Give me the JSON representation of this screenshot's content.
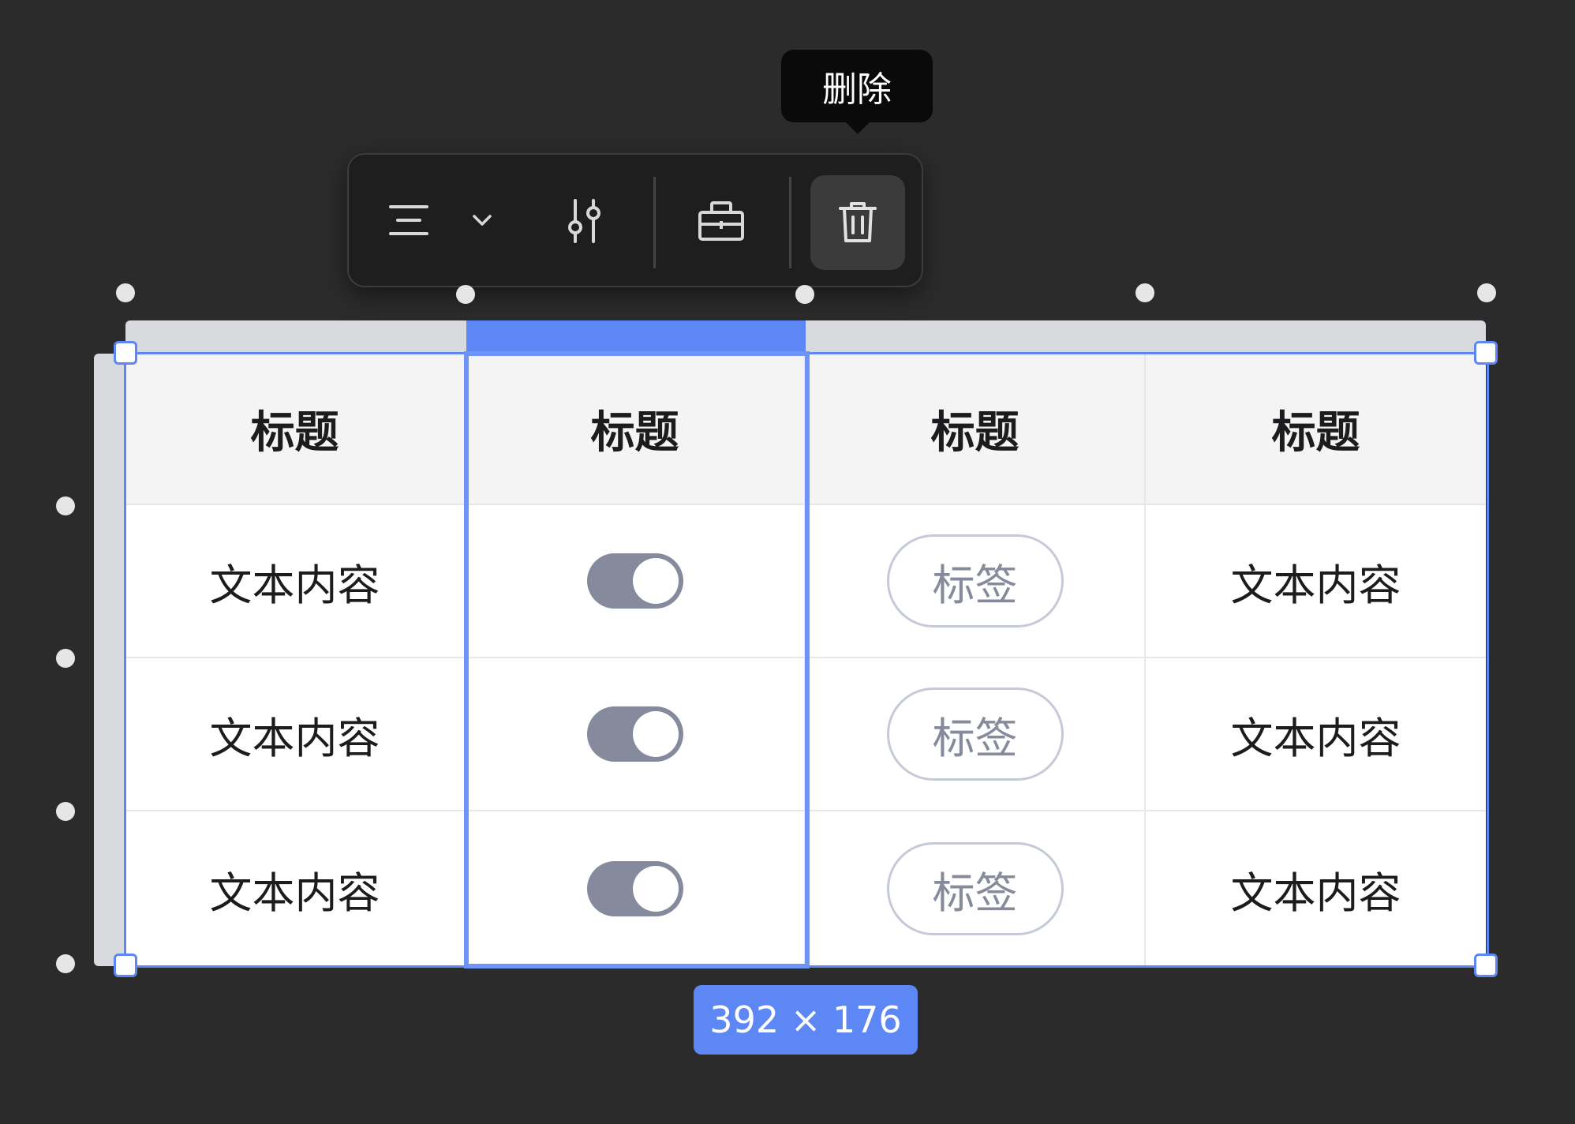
{
  "tooltip": {
    "text": "删除"
  },
  "toolbar": {
    "items": [
      {
        "icon": "align-center-icon"
      },
      {
        "icon": "chevron-down-icon"
      },
      {
        "icon": "sliders-icon"
      },
      {
        "icon": "briefcase-icon"
      },
      {
        "icon": "trash-icon"
      }
    ]
  },
  "table": {
    "headers": [
      "标题",
      "标题",
      "标题",
      "标题"
    ],
    "rows": [
      {
        "col1": "文本内容",
        "col2_toggle_on": true,
        "col3_tag": "标签",
        "col4": "文本内容"
      },
      {
        "col1": "文本内容",
        "col2_toggle_on": true,
        "col3_tag": "标签",
        "col4": "文本内容"
      },
      {
        "col1": "文本内容",
        "col2_toggle_on": true,
        "col3_tag": "标签",
        "col4": "文本内容"
      }
    ]
  },
  "size_badge": "392 × 176",
  "colors": {
    "accent": "#5c87f5",
    "toggle": "#858a9c",
    "tag_border": "#c5cad8",
    "canvas": "#2b2b2b"
  }
}
